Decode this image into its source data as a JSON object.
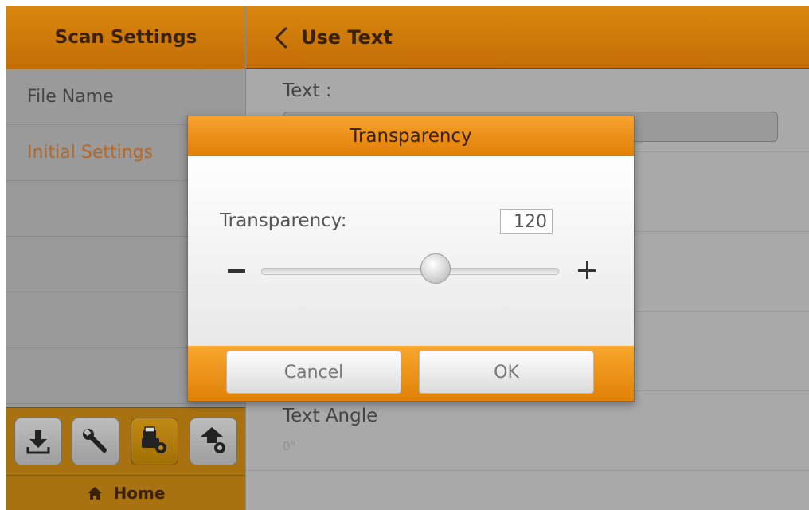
{
  "sidebar": {
    "title": "Scan Settings",
    "items": [
      {
        "label": "File Name"
      },
      {
        "label": "Initial Settings"
      }
    ],
    "toolbar": [
      "download-icon",
      "wrench-icon",
      "scanner-settings-icon",
      "upload-settings-icon"
    ],
    "footer": {
      "label": "Home",
      "icon": "home-icon"
    }
  },
  "main": {
    "title": "Use Text",
    "text_label": "Text :",
    "text_value": "",
    "angle_label": "Text Angle",
    "angle_value": "0°"
  },
  "dialog": {
    "title": "Transparency",
    "label": "Transparency:",
    "value": "120",
    "slider_fraction": 0.59,
    "cancel_label": "Cancel",
    "ok_label": "OK"
  },
  "colors": {
    "accent": "#d9870f",
    "accent_light": "#f7a22f",
    "selected_text": "#b5682b"
  }
}
